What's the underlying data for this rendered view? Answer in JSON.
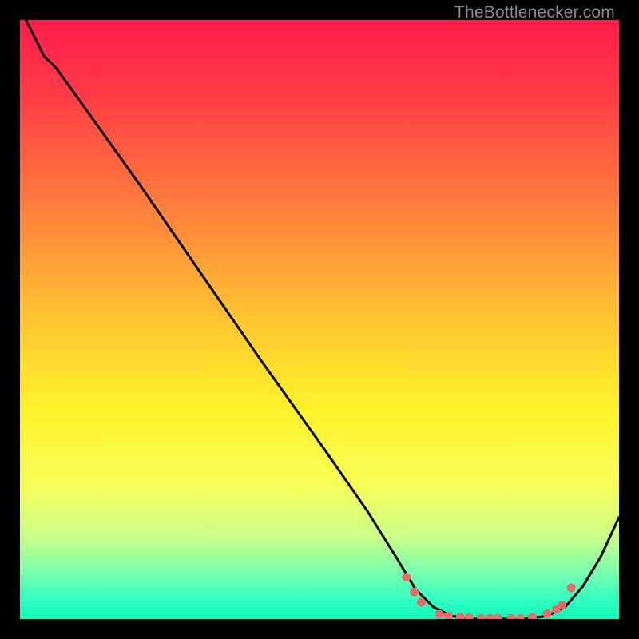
{
  "watermark": "TheBottlenecker.com",
  "colors": {
    "bg": "#000000",
    "curve": "#000000",
    "dots": "#e86a6a"
  },
  "chart_data": {
    "type": "line",
    "title": "",
    "xlabel": "",
    "ylabel": "",
    "xlim": [
      0,
      100
    ],
    "ylim": [
      0,
      100
    ],
    "gradient_stops": [
      {
        "pos": 0.0,
        "color": "#ff1c4b"
      },
      {
        "pos": 0.12,
        "color": "#ff3a46"
      },
      {
        "pos": 0.3,
        "color": "#ff7a3d"
      },
      {
        "pos": 0.5,
        "color": "#ffc531"
      },
      {
        "pos": 0.65,
        "color": "#fff22a"
      },
      {
        "pos": 0.78,
        "color": "#f6ff5a"
      },
      {
        "pos": 0.86,
        "color": "#ccff87"
      },
      {
        "pos": 0.92,
        "color": "#7cffad"
      },
      {
        "pos": 0.97,
        "color": "#2dffc3"
      },
      {
        "pos": 1.0,
        "color": "#10f7b8"
      }
    ],
    "series": [
      {
        "name": "bottleneck-curve",
        "data": [
          {
            "x": 1.0,
            "y": 100.0
          },
          {
            "x": 4.0,
            "y": 94.0
          },
          {
            "x": 6.0,
            "y": 92.0
          },
          {
            "x": 10.0,
            "y": 86.5
          },
          {
            "x": 20.0,
            "y": 72.5
          },
          {
            "x": 30.0,
            "y": 58.0
          },
          {
            "x": 40.0,
            "y": 43.5
          },
          {
            "x": 50.0,
            "y": 29.5
          },
          {
            "x": 58.0,
            "y": 18.0
          },
          {
            "x": 63.0,
            "y": 10.0
          },
          {
            "x": 66.0,
            "y": 5.0
          },
          {
            "x": 69.0,
            "y": 2.0
          },
          {
            "x": 72.0,
            "y": 0.5
          },
          {
            "x": 76.0,
            "y": 0.0
          },
          {
            "x": 80.0,
            "y": 0.0
          },
          {
            "x": 84.0,
            "y": 0.0
          },
          {
            "x": 88.0,
            "y": 0.5
          },
          {
            "x": 91.0,
            "y": 2.0
          },
          {
            "x": 94.0,
            "y": 5.5
          },
          {
            "x": 97.0,
            "y": 10.5
          },
          {
            "x": 100.0,
            "y": 17.0
          }
        ]
      }
    ],
    "dots": [
      {
        "x": 64.5,
        "y": 7.0
      },
      {
        "x": 65.8,
        "y": 4.5
      },
      {
        "x": 67.0,
        "y": 2.8
      },
      {
        "x": 70.0,
        "y": 0.8
      },
      {
        "x": 71.5,
        "y": 0.5
      },
      {
        "x": 73.5,
        "y": 0.3
      },
      {
        "x": 75.0,
        "y": 0.2
      },
      {
        "x": 77.0,
        "y": 0.1
      },
      {
        "x": 78.5,
        "y": 0.1
      },
      {
        "x": 79.8,
        "y": 0.1
      },
      {
        "x": 82.0,
        "y": 0.1
      },
      {
        "x": 83.5,
        "y": 0.1
      },
      {
        "x": 85.5,
        "y": 0.3
      },
      {
        "x": 88.0,
        "y": 0.9
      },
      {
        "x": 89.5,
        "y": 1.6
      },
      {
        "x": 90.5,
        "y": 2.3
      },
      {
        "x": 92.0,
        "y": 5.2
      }
    ]
  }
}
